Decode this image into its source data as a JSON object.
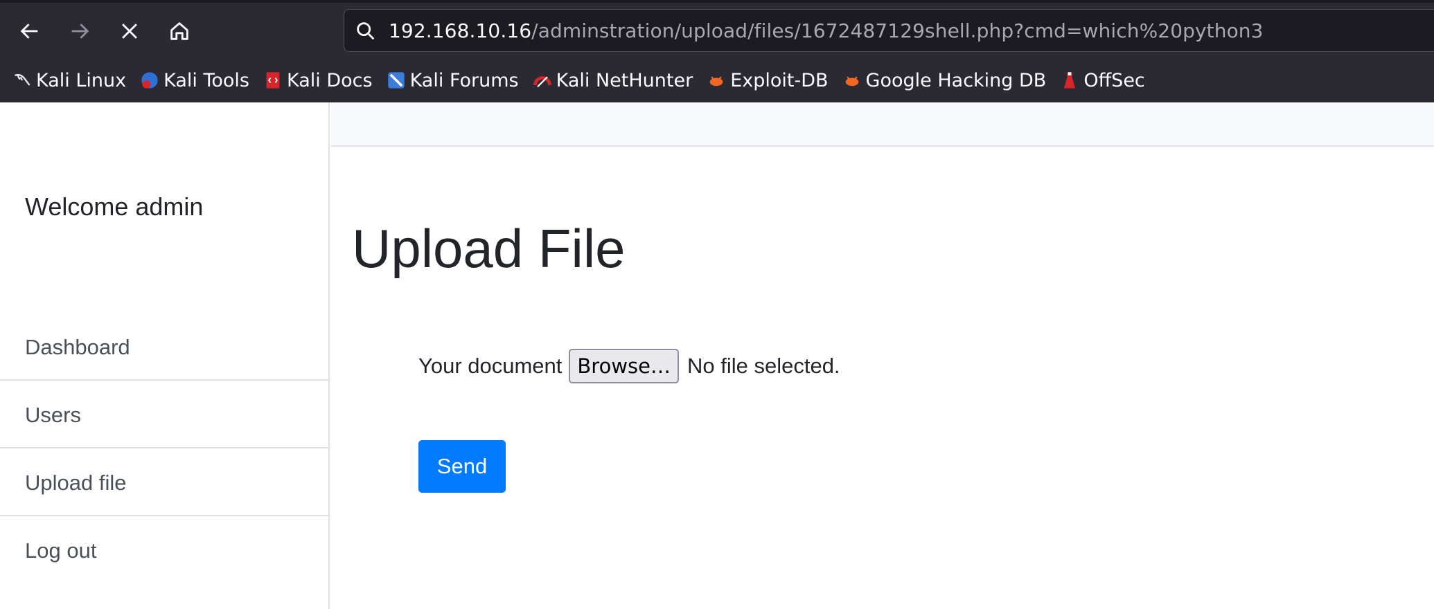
{
  "browser": {
    "url_host": "192.168.10.16",
    "url_path": "/adminstration/upload/files/1672487129shell.php?cmd=which%20python3",
    "bookmarks": [
      {
        "label": "Kali Linux",
        "icon": "kali-dragon-icon",
        "color": "#111111"
      },
      {
        "label": "Kali Tools",
        "icon": "kali-tools-icon",
        "color": "#2f6fd6"
      },
      {
        "label": "Kali Docs",
        "icon": "kali-docs-icon",
        "color": "#d6262b"
      },
      {
        "label": "Kali Forums",
        "icon": "kali-forums-icon",
        "color": "#3b7ddd"
      },
      {
        "label": "Kali NetHunter",
        "icon": "kali-nethunter-icon",
        "color": "#d6262b"
      },
      {
        "label": "Exploit-DB",
        "icon": "exploit-db-icon",
        "color": "#f26722"
      },
      {
        "label": "Google Hacking DB",
        "icon": "ghdb-icon",
        "color": "#f26722"
      },
      {
        "label": "OffSec",
        "icon": "offsec-icon",
        "color": "#d6262b"
      }
    ]
  },
  "sidebar": {
    "welcome": "Welcome admin",
    "items": [
      {
        "label": "Dashboard"
      },
      {
        "label": "Users"
      },
      {
        "label": "Upload file"
      },
      {
        "label": "Log out"
      }
    ]
  },
  "main": {
    "title": "Upload File",
    "form": {
      "label": "Your document",
      "browse_label": "Browse…",
      "file_status": "No file selected.",
      "submit_label": "Send"
    }
  },
  "colors": {
    "chrome_bg": "#2b2a33",
    "accent": "#007bff"
  }
}
